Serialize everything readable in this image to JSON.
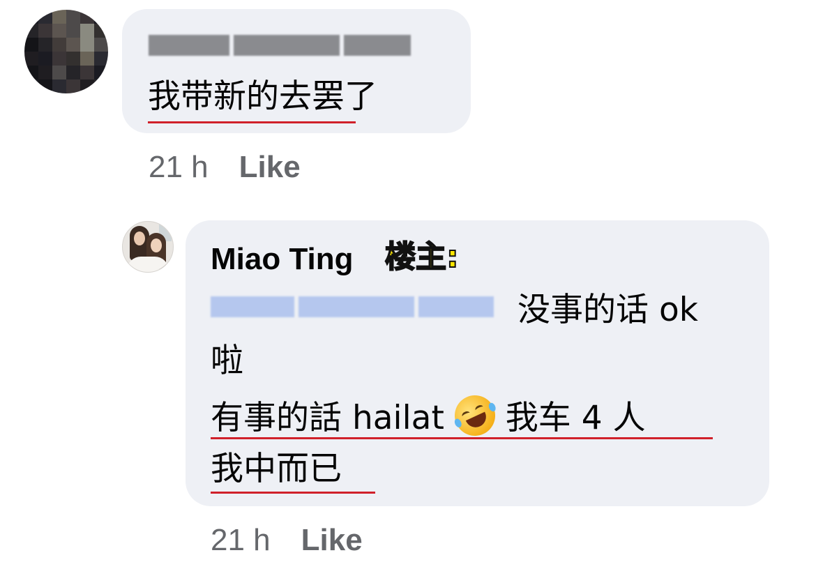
{
  "comment_1": {
    "text": "我带新的去罢了",
    "time": "21 h",
    "like_label": "Like"
  },
  "reply_1": {
    "author": "Miao Ting",
    "author_badge": "楼主:",
    "line_1_suffix": "没事的话 ok",
    "line_2": "啦",
    "line_3_a": "有事的話 hailat",
    "line_3_emoji": "rolling-on-floor-laughing-emoji",
    "line_3_b": "我车 4 人",
    "line_4": "我中而已",
    "time": "21 h",
    "like_label": "Like"
  },
  "colors": {
    "bubble": "#eef0f5",
    "meta_text": "#65676b",
    "underline": "#d0202a",
    "badge_fill": "#ffe600",
    "mention_blur": "#b5c7ee"
  }
}
